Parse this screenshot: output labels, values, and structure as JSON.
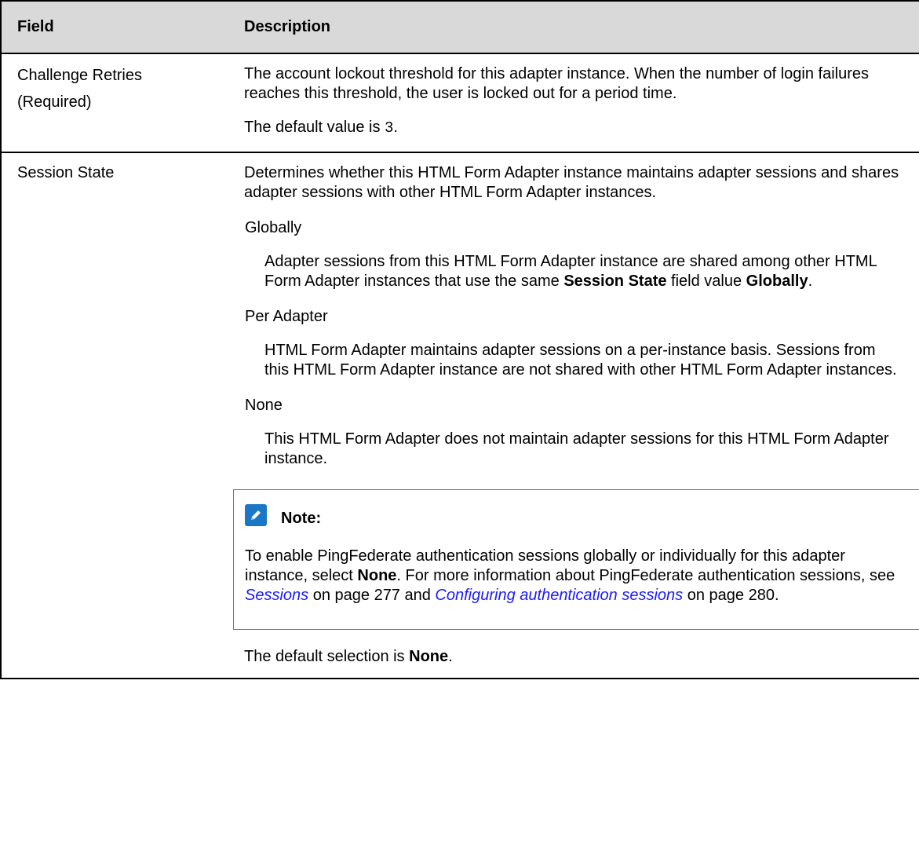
{
  "header": {
    "col_field": "Field",
    "col_description": "Description"
  },
  "rows": {
    "challenge": {
      "field_name": "Challenge Retries",
      "field_required": "(Required)",
      "desc1": "The account lockout threshold for this adapter instance. When the number of login failures reaches this threshold, the user is locked out for a period time.",
      "default_prefix": "The default value is ",
      "default_value": "3",
      "default_suffix": "."
    },
    "session": {
      "field_name": "Session State",
      "desc1": "Determines whether this HTML Form Adapter instance maintains adapter sessions and shares adapter sessions with other HTML Form Adapter instances.",
      "options": {
        "globally_term": "Globally",
        "globally_def_a": "Adapter sessions from this HTML Form Adapter instance are shared among other HTML Form Adapter instances that use the same ",
        "globally_def_b": "Session State",
        "globally_def_c": " field value ",
        "globally_def_d": "Globally",
        "globally_def_e": ".",
        "per_term": "Per Adapter",
        "per_def": "HTML Form Adapter maintains adapter sessions on a per-instance basis. Sessions from this HTML Form Adapter instance are not shared with other HTML Form Adapter instances.",
        "none_term": "None",
        "none_def": "This HTML Form Adapter does not maintain adapter sessions for this HTML Form Adapter instance."
      },
      "note": {
        "title": "Note:",
        "t1": "To enable PingFederate authentication sessions globally or individually for this adapter instance, select ",
        "t2": "None",
        "t3": ". For more information about PingFederate authentication sessions, see ",
        "link1": "Sessions",
        "t4": " on page 277 and ",
        "link2": "Configuring authentication sessions",
        "t5": " on page 280."
      },
      "default_prefix": "The default selection is ",
      "default_value": "None",
      "default_suffix": "."
    }
  },
  "colors": {
    "header_bg": "#d9d9d9",
    "link": "#1a1aff",
    "note_icon": "#1a76c6"
  },
  "icons": {
    "note": "pencil-icon"
  }
}
